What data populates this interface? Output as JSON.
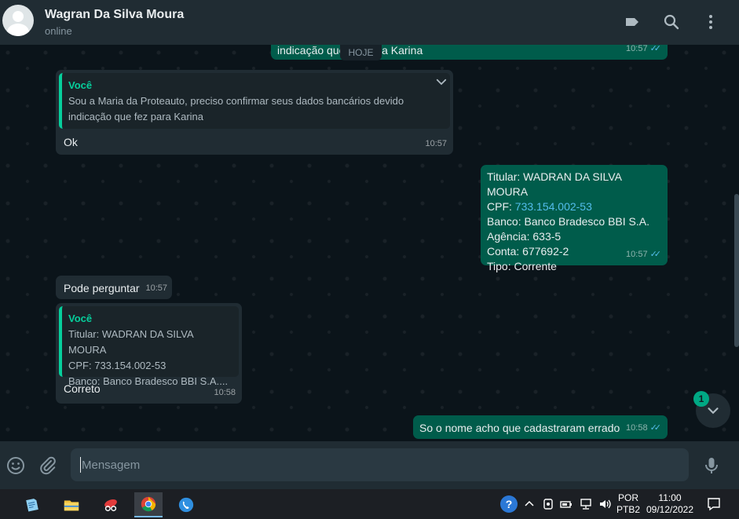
{
  "header": {
    "contact_name": "Wagran Da Silva Moura",
    "status": "online",
    "icons": [
      "label-icon",
      "search-icon",
      "more-vertical-icon"
    ]
  },
  "chat": {
    "date_divider": "HOJE",
    "messages": [
      {
        "direction": "out",
        "text": "indicação que fez para Karina",
        "time": "10:57",
        "ticks": "read"
      },
      {
        "direction": "in",
        "quote_author": "Você",
        "quote_line1": "Sou a Maria da Proteauto, preciso confirmar seus dados  bancários devido",
        "quote_line2": "indicação que fez para Karina",
        "text": "Ok",
        "time": "10:57"
      },
      {
        "direction": "out",
        "lines": {
          "titular": "Titular: WADRAN DA SILVA MOURA",
          "cpf_label": "CPF: ",
          "cpf_value": "733.154.002-53",
          "banco": "Banco: Banco Bradesco BBI S.A.",
          "agencia": "Agência: 633-5",
          "conta": "Conta: 677692-2",
          "tipo": "Tipo: Corrente"
        },
        "time": "10:57",
        "ticks": "read"
      },
      {
        "direction": "in",
        "text": "Pode perguntar",
        "time": "10:57"
      },
      {
        "direction": "in",
        "quote_author": "Você",
        "quote_line1": "Titular: WADRAN DA SILVA MOURA",
        "quote_line2": "CPF: 733.154.002-53",
        "quote_line3": "Banco: Banco Bradesco BBI S.A....",
        "text": "Correto",
        "time": "10:58"
      },
      {
        "direction": "out",
        "text": "So o nome acho que cadastraram errado",
        "time": "10:58",
        "ticks": "read"
      }
    ],
    "unread_count": "1"
  },
  "composer": {
    "placeholder": "Mensagem"
  },
  "taskbar": {
    "lang_line1": "POR",
    "lang_line2": "PTB2",
    "clock_time": "11:00",
    "clock_date": "09/12/2022"
  },
  "colors": {
    "outgoing": "#005c4b",
    "incoming": "#202c33",
    "accent": "#06cf9c",
    "ticks": "#53bdeb"
  }
}
